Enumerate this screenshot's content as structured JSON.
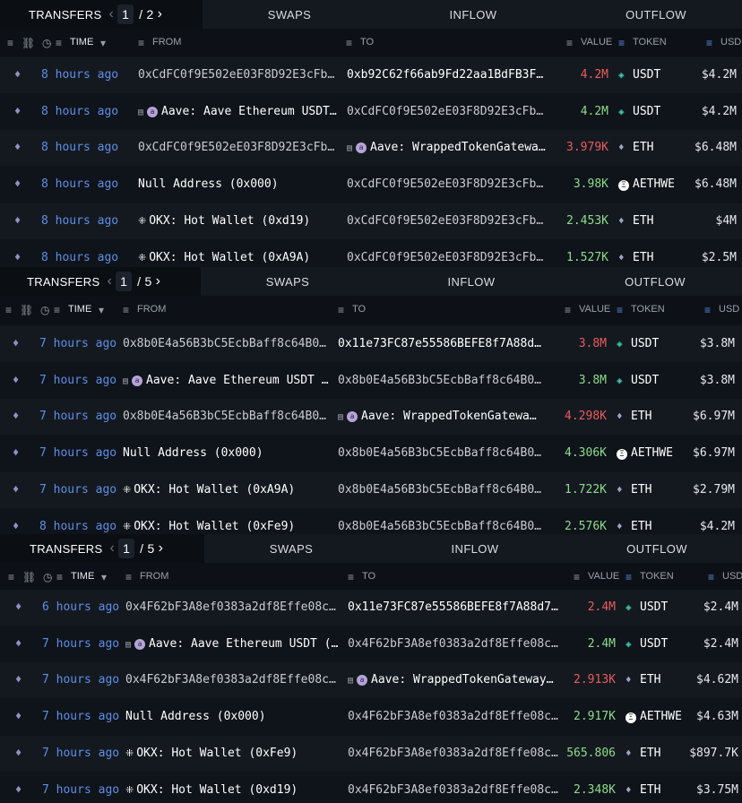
{
  "colors": {
    "value_out": "#ea5c5c",
    "value_in": "#8ddc8a",
    "time_link": "#5e8fe6",
    "usdt": "#3fd1b4"
  },
  "header": {
    "time": "TIME",
    "from": "FROM",
    "to": "TO",
    "value": "VALUE",
    "token": "TOKEN",
    "usd": "USD"
  },
  "tables": [
    {
      "tabs": {
        "transfers": "TRANSFERS",
        "page": "1",
        "of": "/ 2",
        "swaps": "SWAPS",
        "inflow": "INFLOW",
        "outflow": "OUTFLOW"
      },
      "rows": [
        {
          "time": "8 hours ago",
          "from": "0xCdFC0f9E502eE03F8D92E3cFbC1...",
          "to": "0xb92C62f66ab9Fd22aa1BdFB3FD0...",
          "value": "4.2M",
          "token": "USDT",
          "usd": "$4.2M"
        },
        {
          "time": "8 hours ago",
          "from": "Aave: Aave Ethereum USDT (...",
          "to": "0xCdFC0f9E502eE03F8D92E3cFbC1...",
          "value": "4.2M",
          "token": "USDT",
          "usd": "$4.2M"
        },
        {
          "time": "8 hours ago",
          "from": "0xCdFC0f9E502eE03F8D92E3cFbC1...",
          "to": "Aave: WrappedTokenGateway...",
          "value": "3.979K",
          "token": "ETH",
          "usd": "$6.48M"
        },
        {
          "time": "8 hours ago",
          "from": "Null Address (0x000)",
          "to": "0xCdFC0f9E502eE03F8D92E3cFbC1...",
          "value": "3.98K",
          "token": "AETHWE",
          "usd": "$6.48M"
        },
        {
          "time": "8 hours ago",
          "from": "OKX: Hot Wallet (0xd19)",
          "to": "0xCdFC0f9E502eE03F8D92E3cFbC1...",
          "value": "2.453K",
          "token": "ETH",
          "usd": "$4M"
        },
        {
          "time": "8 hours ago",
          "from": "OKX: Hot Wallet (0xA9A)",
          "to": "0xCdFC0f9E502eE03F8D92E3cFbC1...",
          "value": "1.527K",
          "token": "ETH",
          "usd": "$2.5M"
        }
      ]
    },
    {
      "tabs": {
        "transfers": "TRANSFERS",
        "page": "1",
        "of": "/ 5",
        "swaps": "SWAPS",
        "inflow": "INFLOW",
        "outflow": "OUTFLOW"
      },
      "rows": [
        {
          "time": "7 hours ago",
          "from": "0x8b0E4a56B3bC5EcbBaff8c64B069...",
          "to": "0x11e73FC87e55586BEFE8f7A88d79...",
          "value": "3.8M",
          "token": "USDT",
          "usd": "$3.8M"
        },
        {
          "time": "7 hours ago",
          "from": "Aave: Aave Ethereum USDT (...",
          "to": "0x8b0E4a56B3bC5EcbBaff8c64B069...",
          "value": "3.8M",
          "token": "USDT",
          "usd": "$3.8M"
        },
        {
          "time": "7 hours ago",
          "from": "0x8b0E4a56B3bC5EcbBaff8c64B069...",
          "to": "Aave: WrappedTokenGatewayV...",
          "value": "4.298K",
          "token": "ETH",
          "usd": "$6.97M"
        },
        {
          "time": "7 hours ago",
          "from": "Null Address (0x000)",
          "to": "0x8b0E4a56B3bC5EcbBaff8c64B069...",
          "value": "4.306K",
          "token": "AETHWE",
          "usd": "$6.97M"
        },
        {
          "time": "7 hours ago",
          "from": "OKX: Hot Wallet (0xA9A)",
          "to": "0x8b0E4a56B3bC5EcbBaff8c64B069...",
          "value": "1.722K",
          "token": "ETH",
          "usd": "$2.79M"
        },
        {
          "time": "8 hours ago",
          "from": "OKX: Hot Wallet (0xFe9)",
          "to": "0x8b0E4a56B3bC5EcbBaff8c64B069...",
          "value": "2.576K",
          "token": "ETH",
          "usd": "$4.2M"
        }
      ]
    },
    {
      "tabs": {
        "transfers": "TRANSFERS",
        "page": "1",
        "of": "/ 5",
        "swaps": "SWAPS",
        "inflow": "INFLOW",
        "outflow": "OUTFLOW"
      },
      "rows": [
        {
          "time": "6 hours ago",
          "from": "0x4F62bF3A8ef0383a2df8Effe08c65...",
          "to": "0x11e73FC87e55586BEFE8f7A88d793...",
          "value": "2.4M",
          "token": "USDT",
          "usd": "$2.4M"
        },
        {
          "time": "7 hours ago",
          "from": "Aave: Aave Ethereum USDT (a...",
          "to": "0x4F62bF3A8ef0383a2df8Effe08c65...",
          "value": "2.4M",
          "token": "USDT",
          "usd": "$2.4M"
        },
        {
          "time": "7 hours ago",
          "from": "0x4F62bF3A8ef0383a2df8Effe08c65...",
          "to": "Aave: WrappedTokenGatewayV3...",
          "value": "2.913K",
          "token": "ETH",
          "usd": "$4.62M"
        },
        {
          "time": "7 hours ago",
          "from": "Null Address (0x000)",
          "to": "0x4F62bF3A8ef0383a2df8Effe08c65...",
          "value": "2.917K",
          "token": "AETHWE",
          "usd": "$4.63M"
        },
        {
          "time": "7 hours ago",
          "from": "OKX: Hot Wallet (0xFe9)",
          "to": "0x4F62bF3A8ef0383a2df8Effe08c65...",
          "value": "565.806",
          "token": "ETH",
          "usd": "$897.7K"
        },
        {
          "time": "7 hours ago",
          "from": "OKX: Hot Wallet (0xd19)",
          "to": "0x4F62bF3A8ef0383a2df8Effe08c65...",
          "value": "2.348K",
          "token": "ETH",
          "usd": "$3.75M"
        }
      ]
    }
  ]
}
